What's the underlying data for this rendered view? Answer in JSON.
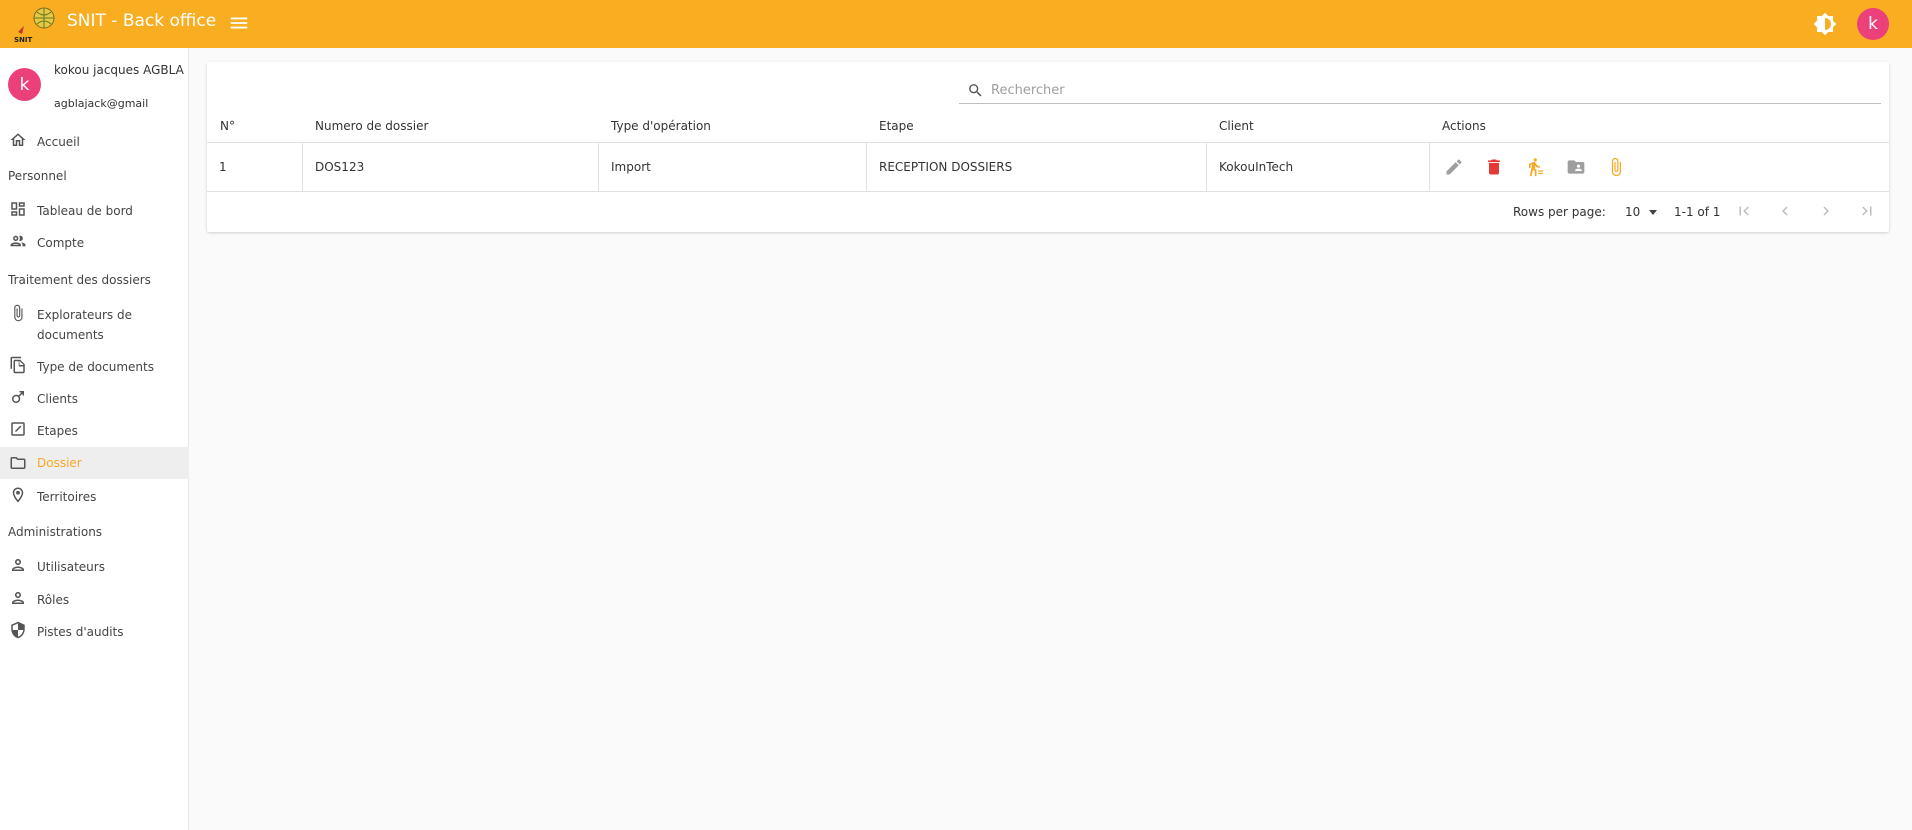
{
  "app": {
    "title": "SNIT - Back office",
    "logo_text": "SNIT",
    "avatar_letter": "k",
    "brand_color": "#f9ad21",
    "accent_color": "#ec407a",
    "icons": {
      "menu": "menu-icon",
      "theme": "brightness-icon"
    }
  },
  "profile": {
    "avatar_letter": "k",
    "name": "kokou jacques AGBLA",
    "email": "agblajack@gmail"
  },
  "sidebar": {
    "items": [
      {
        "label": "Accueil",
        "icon": "home-icon"
      },
      {
        "section": "Personnel"
      },
      {
        "label": "Tableau de bord",
        "icon": "dashboard-icon"
      },
      {
        "label": "Compte",
        "icon": "people-icon"
      },
      {
        "section": "Traitement des dossiers"
      },
      {
        "label": "Explorateurs de documents",
        "icon": "attachment-icon"
      },
      {
        "label": "Type de documents",
        "icon": "file-copy-icon"
      },
      {
        "label": "Clients",
        "icon": "male-icon"
      },
      {
        "label": "Etapes",
        "icon": "edit-square-icon"
      },
      {
        "label": "Dossier",
        "icon": "folder-icon",
        "active": true
      },
      {
        "label": "Territoires",
        "icon": "location-icon"
      },
      {
        "section": "Administrations"
      },
      {
        "label": "Utilisateurs",
        "icon": "person-icon"
      },
      {
        "label": "Rôles",
        "icon": "person-icon"
      },
      {
        "label": "Pistes d'audits",
        "icon": "shield-icon"
      }
    ]
  },
  "search": {
    "placeholder": "Rechercher",
    "value": ""
  },
  "table": {
    "columns": [
      "N°",
      "Numero de dossier",
      "Type d'opération",
      "Etape",
      "Client",
      "Actions"
    ],
    "rows": [
      {
        "n": "1",
        "numero": "DOS123",
        "type": "Import",
        "etape": "RECEPTION DOSSIERS",
        "client": "KokouInTech"
      }
    ],
    "actions": [
      "edit-icon",
      "delete-icon",
      "assign-step-icon",
      "shared-folder-icon",
      "attachment-icon"
    ],
    "action_colors": {
      "edit": "#9e9e9e",
      "delete": "#e53935",
      "assign": "#f9a825",
      "folder": "#9e9e9e",
      "attach": "#f9a825"
    }
  },
  "pagination": {
    "rows_per_page_label": "Rows per page:",
    "rows_per_page": "10",
    "range": "1-1 of 1"
  }
}
